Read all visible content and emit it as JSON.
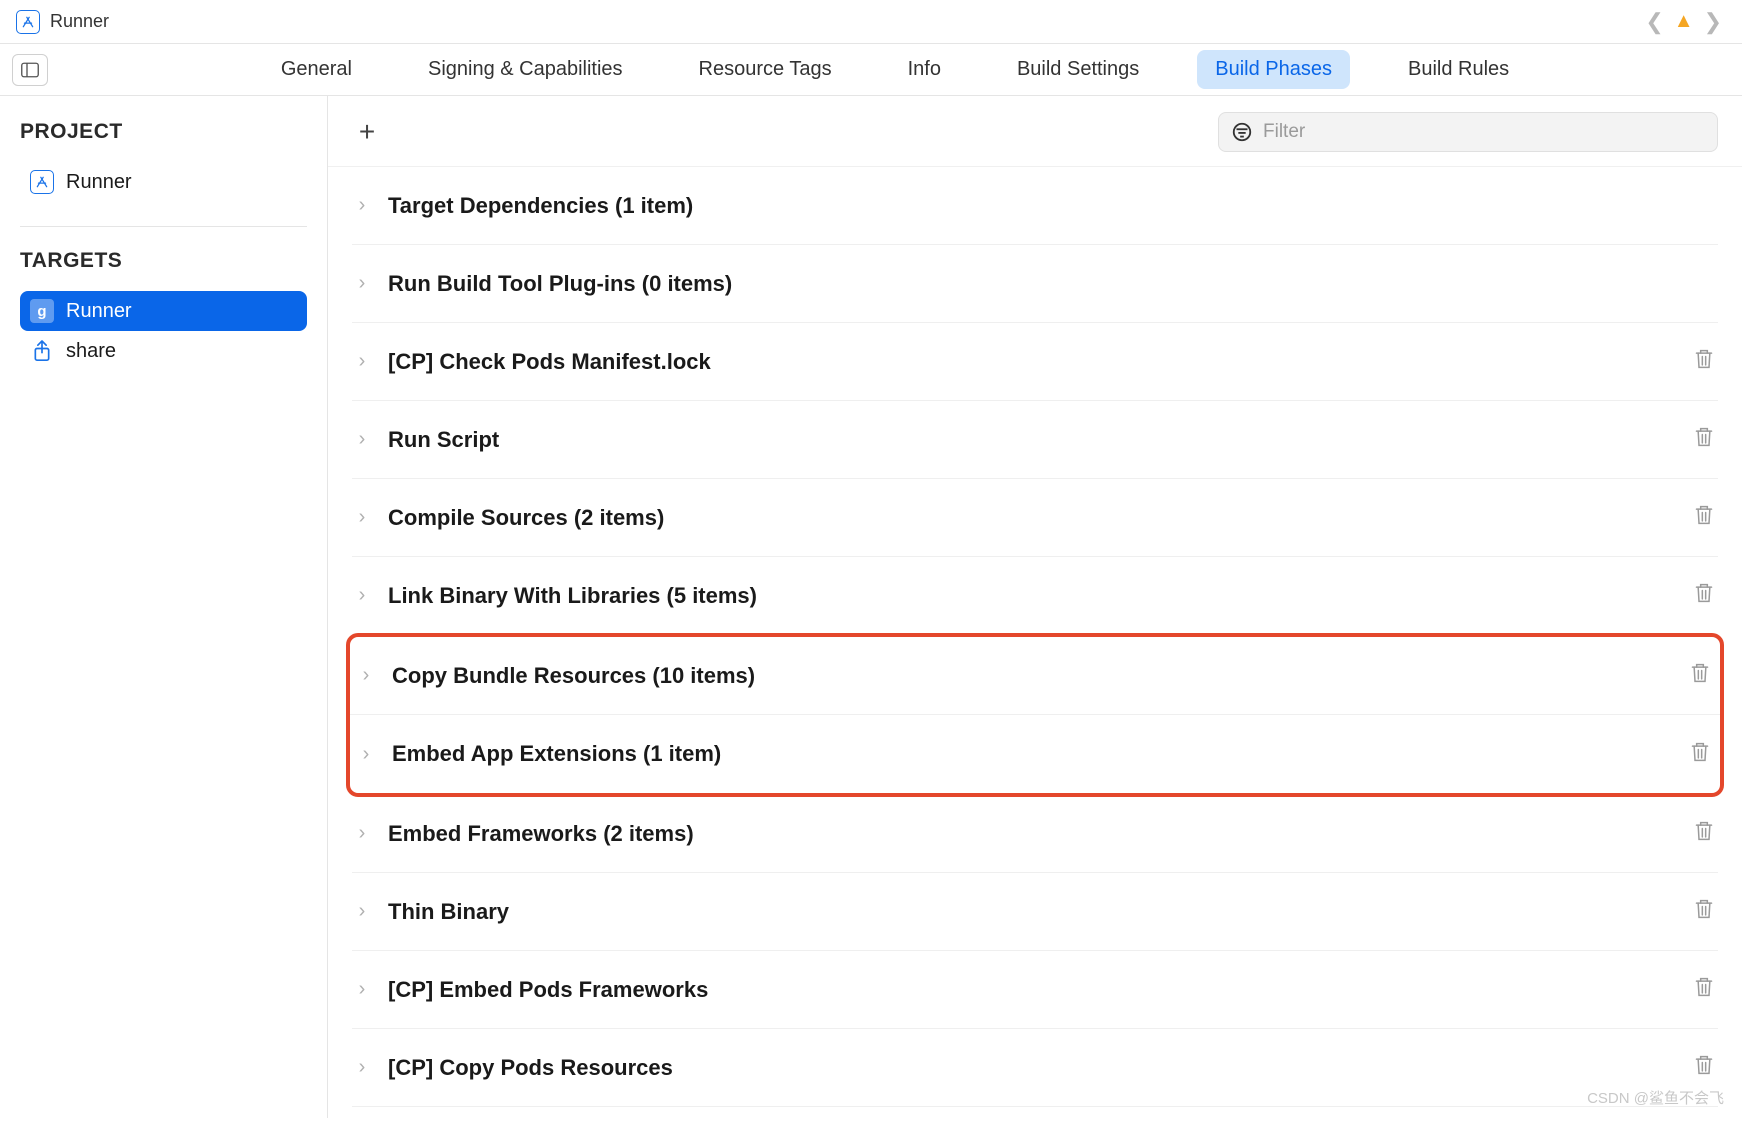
{
  "header": {
    "title": "Runner"
  },
  "tabs": [
    {
      "label": "General",
      "active": false
    },
    {
      "label": "Signing & Capabilities",
      "active": false
    },
    {
      "label": "Resource Tags",
      "active": false
    },
    {
      "label": "Info",
      "active": false
    },
    {
      "label": "Build Settings",
      "active": false
    },
    {
      "label": "Build Phases",
      "active": true
    },
    {
      "label": "Build Rules",
      "active": false
    }
  ],
  "sidebar": {
    "project_section": "PROJECT",
    "project_item": "Runner",
    "targets_section": "TARGETS",
    "targets": [
      {
        "label": "Runner",
        "icon": "g",
        "selected": true
      },
      {
        "label": "share",
        "icon": "share",
        "selected": false
      }
    ]
  },
  "filter": {
    "placeholder": "Filter"
  },
  "phases": [
    {
      "label": "Target Dependencies (1 item)",
      "deletable": false
    },
    {
      "label": "Run Build Tool Plug-ins (0 items)",
      "deletable": false
    },
    {
      "label": "[CP] Check Pods Manifest.lock",
      "deletable": true
    },
    {
      "label": "Run Script",
      "deletable": true
    },
    {
      "label": "Compile Sources (2 items)",
      "deletable": true
    },
    {
      "label": "Link Binary With Libraries (5 items)",
      "deletable": true
    },
    {
      "label": "Copy Bundle Resources (10 items)",
      "deletable": true,
      "highlight": true
    },
    {
      "label": "Embed App Extensions (1 item)",
      "deletable": true,
      "highlight": true
    },
    {
      "label": "Embed Frameworks (2 items)",
      "deletable": true
    },
    {
      "label": "Thin Binary",
      "deletable": true
    },
    {
      "label": "[CP] Embed Pods Frameworks",
      "deletable": true
    },
    {
      "label": "[CP] Copy Pods Resources",
      "deletable": true
    }
  ],
  "watermark": "CSDN @鲨鱼不会飞"
}
